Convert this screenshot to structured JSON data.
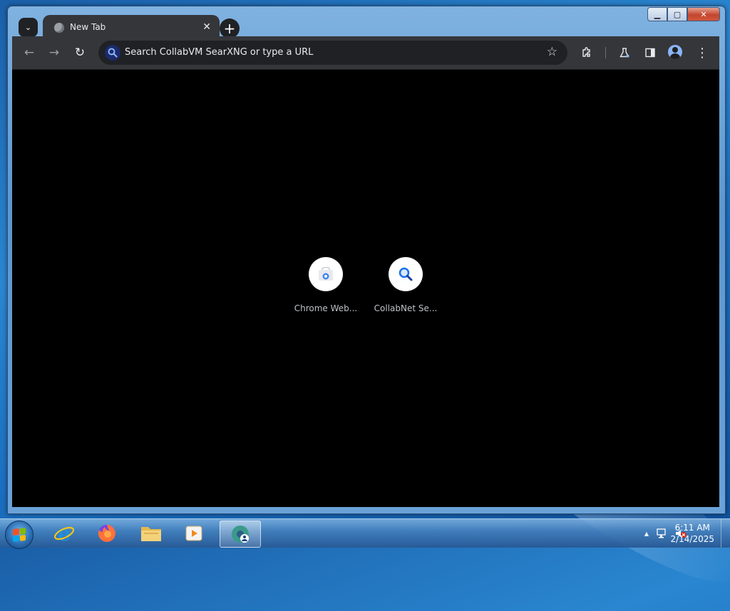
{
  "window": {
    "minimize_glyph": "▁",
    "maximize_glyph": "▢",
    "close_glyph": "✕"
  },
  "browser": {
    "tab": {
      "title": "New Tab",
      "close_glyph": "✕"
    },
    "new_tab_glyph": "+",
    "tab_search_glyph": "⌄",
    "back_glyph": "←",
    "forward_glyph": "→",
    "reload_glyph": "↻",
    "omnibox_placeholder": "Search CollabVM SearXNG or type a URL",
    "star_glyph": "☆",
    "extensions_glyph": "⧉",
    "labs_glyph": "⚗",
    "side_panel_glyph": "◧",
    "menu_glyph": "⋮"
  },
  "shortcuts": [
    {
      "label": "Chrome Web...",
      "icon": "chrome-web-store-icon"
    },
    {
      "label": "CollabNet Se...",
      "icon": "magnifier-icon"
    }
  ],
  "taskbar": {
    "apps": [
      {
        "name": "internet-explorer-icon"
      },
      {
        "name": "firefox-icon"
      },
      {
        "name": "file-explorer-icon"
      },
      {
        "name": "media-player-icon"
      },
      {
        "name": "chrome-collabvm-icon",
        "active": true
      }
    ],
    "tray": {
      "show_hidden_glyph": "▲"
    },
    "clock": {
      "time": "6:11 AM",
      "date": "2/14/2025"
    }
  },
  "colors": {
    "chrome_dark": "#35363a",
    "omnibox_bg": "#202124",
    "content_bg": "#000000",
    "search_blue": "#1a73e8"
  }
}
